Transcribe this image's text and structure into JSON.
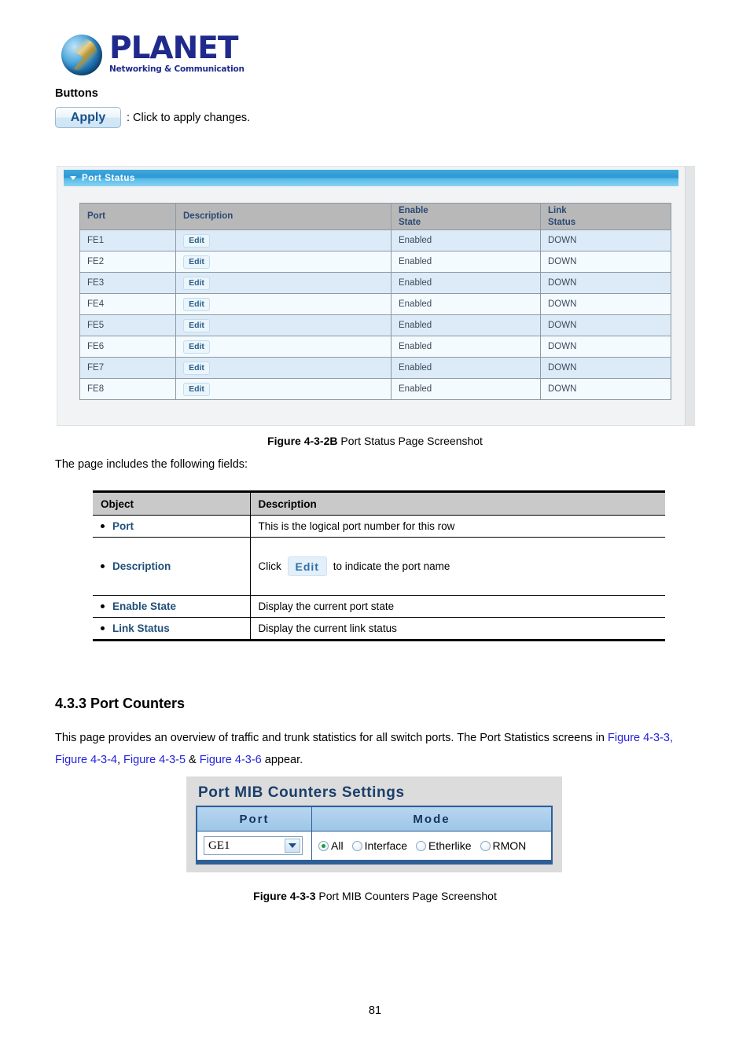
{
  "logo": {
    "name": "PLANET",
    "tagline": "Networking & Communication"
  },
  "buttons_section": {
    "heading": "Buttons",
    "apply_label": "Apply",
    "apply_caption": ": Click to apply changes."
  },
  "port_status_screenshot": {
    "panel_title": "Port Status",
    "columns": [
      "Port",
      "Description",
      "Enable\nState",
      "Link\nStatus"
    ],
    "column_headers": {
      "port": "Port",
      "description": "Description",
      "enable_state_line1": "Enable",
      "enable_state_line2": "State",
      "link_status_line1": "Link",
      "link_status_line2": "Status"
    },
    "edit_label": "Edit",
    "rows": [
      {
        "port": "FE1",
        "description": "Edit",
        "enable_state": "Enabled",
        "link_status": "DOWN"
      },
      {
        "port": "FE2",
        "description": "Edit",
        "enable_state": "Enabled",
        "link_status": "DOWN"
      },
      {
        "port": "FE3",
        "description": "Edit",
        "enable_state": "Enabled",
        "link_status": "DOWN"
      },
      {
        "port": "FE4",
        "description": "Edit",
        "enable_state": "Enabled",
        "link_status": "DOWN"
      },
      {
        "port": "FE5",
        "description": "Edit",
        "enable_state": "Enabled",
        "link_status": "DOWN"
      },
      {
        "port": "FE6",
        "description": "Edit",
        "enable_state": "Enabled",
        "link_status": "DOWN"
      },
      {
        "port": "FE7",
        "description": "Edit",
        "enable_state": "Enabled",
        "link_status": "DOWN"
      },
      {
        "port": "FE8",
        "description": "Edit",
        "enable_state": "Enabled",
        "link_status": "DOWN"
      }
    ]
  },
  "figure_2b_caption": {
    "bold": "Figure 4-3-2B",
    "rest": " Port Status Page Screenshot"
  },
  "includes_line": "The page includes the following fields:",
  "definition_table": {
    "headers": {
      "object": "Object",
      "description": "Description"
    },
    "rows": [
      {
        "object": "Port",
        "description": "This is the logical port number for this row"
      },
      {
        "object": "Description",
        "description_prefix": "Click",
        "button_label": "Edit",
        "description_suffix": "to indicate the port name"
      },
      {
        "object": "Enable State",
        "description": "Display the current port state"
      },
      {
        "object": "Link Status",
        "description": "Display the current link status"
      }
    ]
  },
  "section": {
    "heading": "4.3.3 Port Counters",
    "para_line1_a": "This page provides an overview of traffic and trunk statistics for all switch ports. The Port Statistics screens in ",
    "para_line1_link": "Figure 4-3-3,",
    "para_line2_link1": "Figure 4-3-4",
    "para_line2_sep1": ", ",
    "para_line2_link2": "Figure 4-3-5",
    "para_line2_sep2": " & ",
    "para_line2_link3": "Figure 4-3-6",
    "para_line2_tail": " appear."
  },
  "mib_screenshot": {
    "title": "Port MIB Counters Settings",
    "headers": {
      "port": "Port",
      "mode": "Mode"
    },
    "port_value": "GE1",
    "mode_options": [
      {
        "label": "All",
        "selected": true
      },
      {
        "label": "Interface",
        "selected": false
      },
      {
        "label": "Etherlike",
        "selected": false
      },
      {
        "label": "RMON",
        "selected": false
      }
    ]
  },
  "figure_3_caption": {
    "bold": "Figure 4-3-3",
    "rest": " Port MIB Counters Page Screenshot"
  },
  "page_number": "81",
  "colors": {
    "brand_blue": "#1f2a8c",
    "panel_header": "#2e97d2",
    "row_alt": "#dcebf7",
    "row_plain": "#f4fbff",
    "link": "#2222dd",
    "radio_on": "#1e9e3a"
  }
}
